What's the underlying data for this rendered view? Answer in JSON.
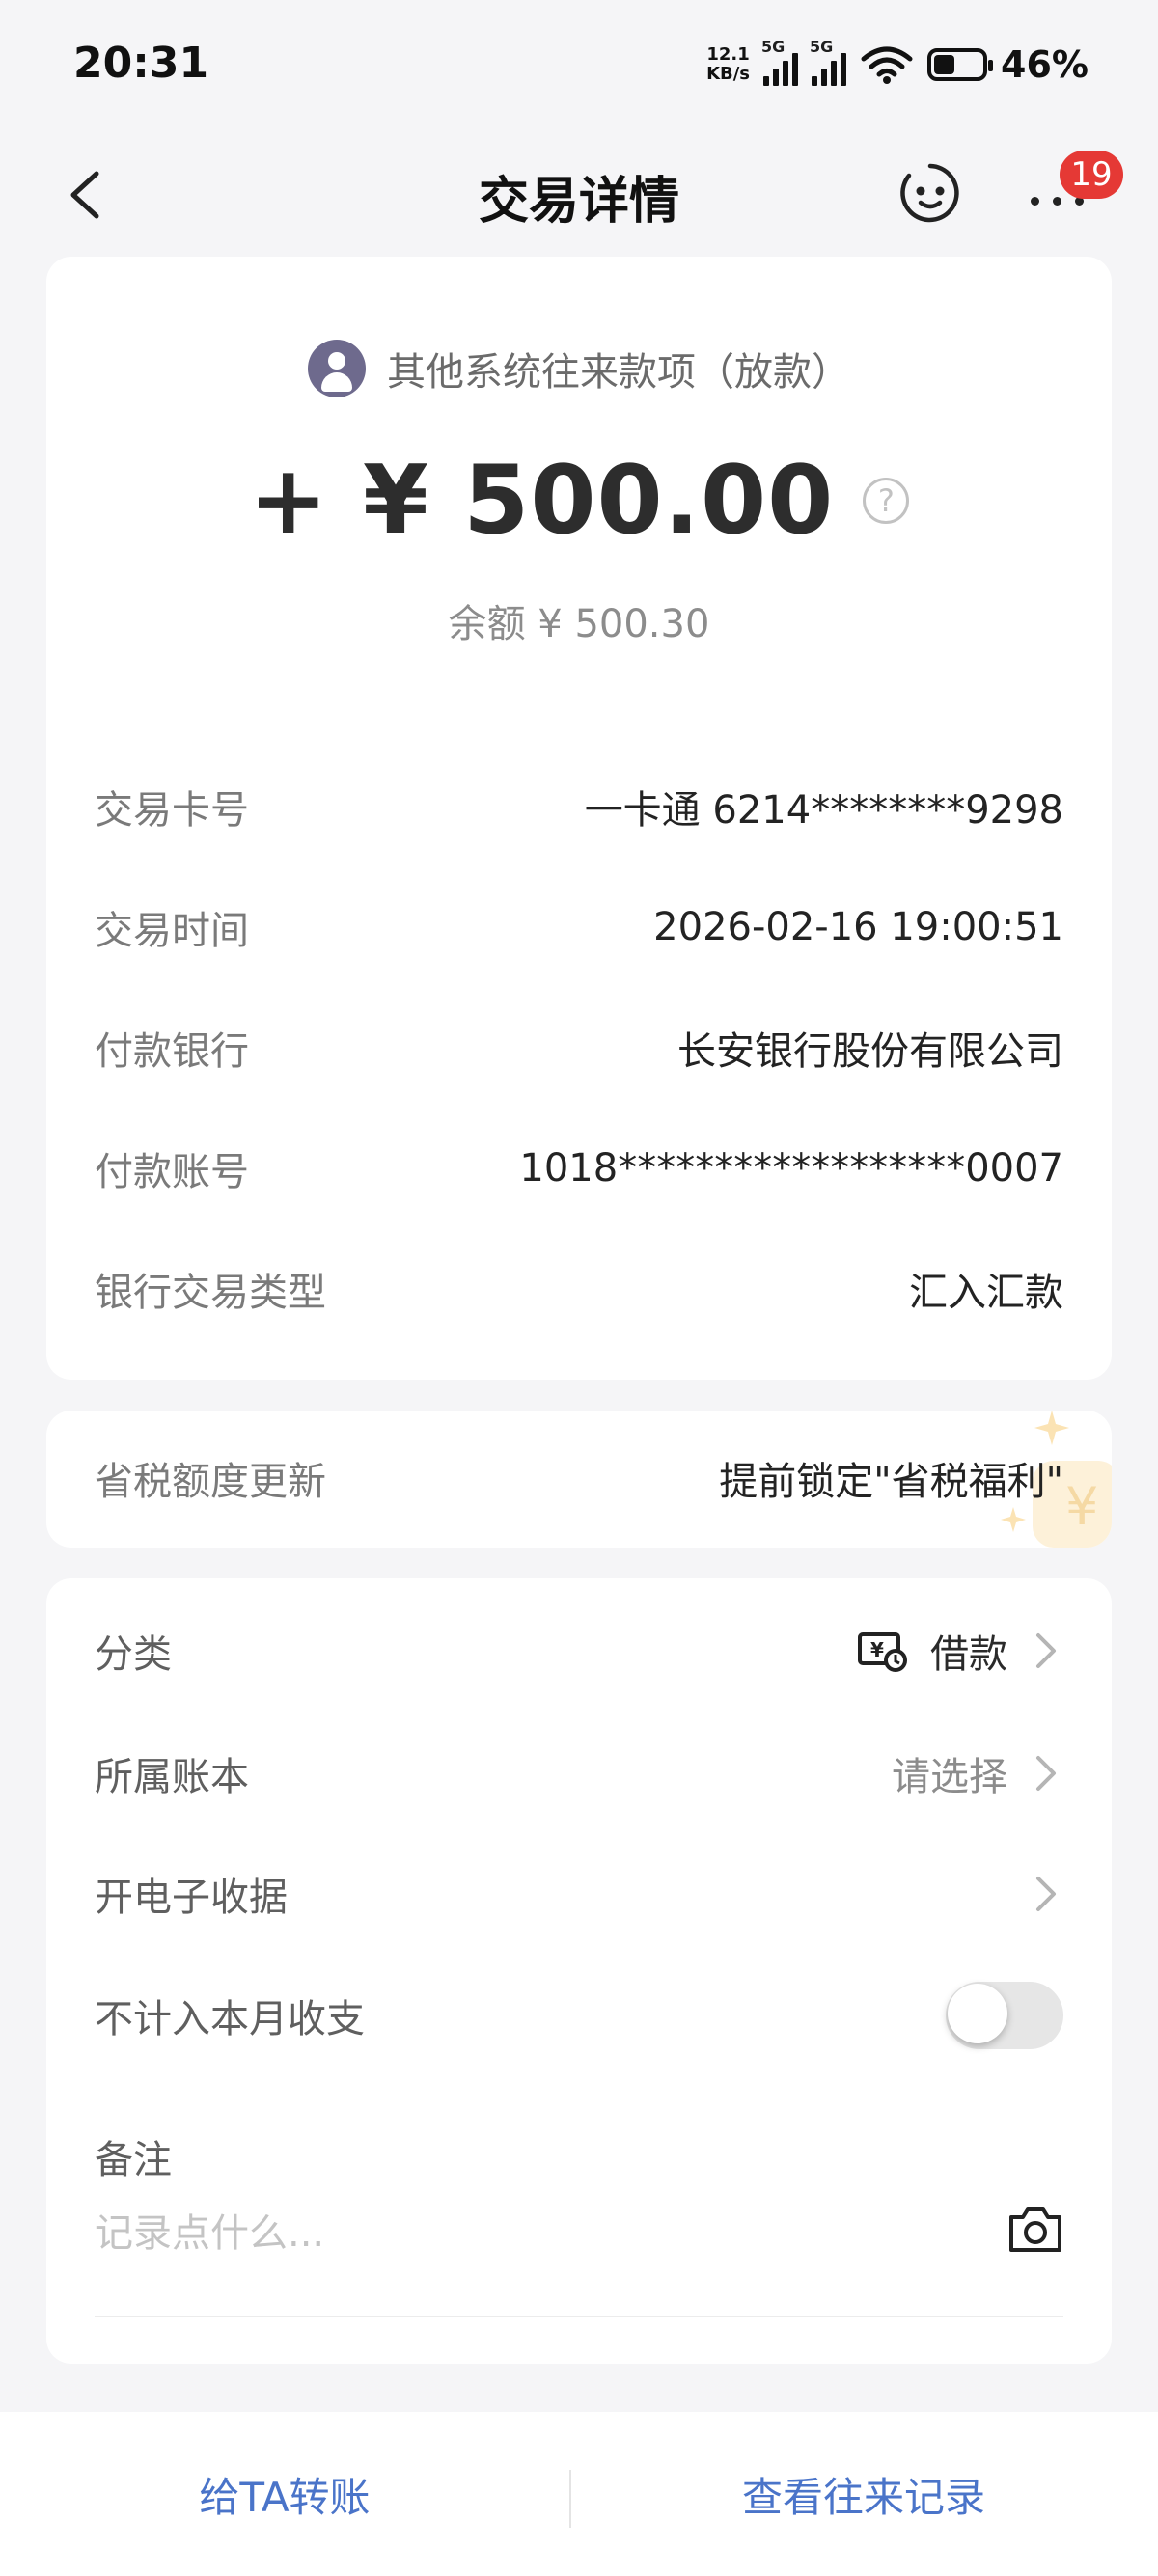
{
  "status_bar": {
    "time": "20:31",
    "net_speed_value": "12.1",
    "net_speed_unit": "KB/s",
    "sim1": "5G",
    "sim2": "5G",
    "battery_percent": "46%",
    "battery_level": 0.46
  },
  "header": {
    "title": "交易详情",
    "notification_badge": "19",
    "back_icon": "chevron-left-icon",
    "assistant_icon": "robot-face-icon",
    "more_icon": "more-dots-icon"
  },
  "summary": {
    "category_text": "其他系统往来款项（放款）",
    "amount": "+ ¥ 500.00",
    "balance": "余额 ¥ 500.30"
  },
  "details": [
    {
      "label": "交易卡号",
      "value": "一卡通 6214********9298"
    },
    {
      "label": "交易时间",
      "value": "2026-02-16 19:00:51"
    },
    {
      "label": "付款银行",
      "value": "长安银行股份有限公司"
    },
    {
      "label": "付款账号",
      "value": "1018******************0007"
    },
    {
      "label": "银行交易类型",
      "value": "汇入汇款"
    }
  ],
  "tax": {
    "label": "省税额度更新",
    "value": "提前锁定\"省税福利\""
  },
  "options": {
    "category": {
      "label": "分类",
      "value": "借款",
      "icon": "loan-category-icon"
    },
    "ledger": {
      "label": "所属账本",
      "value": "请选择"
    },
    "receipt": {
      "label": "开电子收据"
    },
    "exclude": {
      "label": "不计入本月收支",
      "enabled": false
    },
    "note": {
      "label": "备注",
      "placeholder": "记录点什么..."
    }
  },
  "bottom": {
    "transfer_label": "给TA转账",
    "history_label": "查看往来记录"
  },
  "colors": {
    "accent": "#4a74c9",
    "badge": "#e53935",
    "avatar": "#6e6a8d",
    "background": "#f5f5f7"
  }
}
